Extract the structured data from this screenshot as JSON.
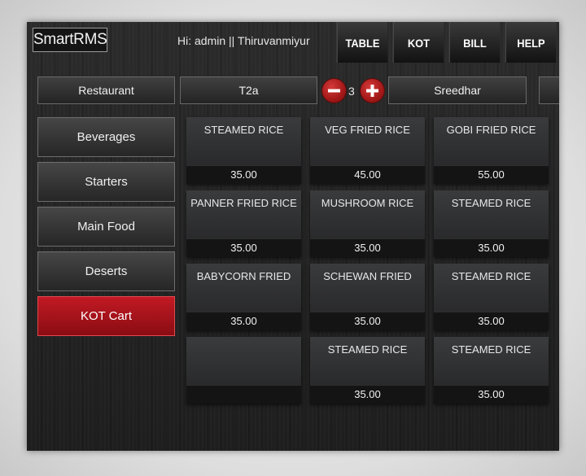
{
  "app": {
    "logo": "SmartRMS"
  },
  "header": {
    "greeting": "Hi: admin  ||  Thiruvanmiyur",
    "nav": [
      "TABLE",
      "KOT",
      "BILL",
      "HELP"
    ]
  },
  "order_bar": {
    "section": "Restaurant",
    "table": "T2a",
    "guests": "3",
    "waiter": "Sreedhar",
    "minus_icon": "minus-circle-icon",
    "plus_icon": "plus-circle-icon"
  },
  "categories": [
    "Beverages",
    "Starters",
    "Main Food",
    "Deserts",
    "KOT Cart"
  ],
  "active_category": "KOT Cart",
  "items": [
    {
      "name": "STEAMED RICE",
      "price": "35.00"
    },
    {
      "name": "VEG FRIED RICE",
      "price": "45.00"
    },
    {
      "name": "GOBI FRIED RICE",
      "price": "55.00"
    },
    {
      "name": "PANNER FRIED RICE",
      "price": "35.00"
    },
    {
      "name": "MUSHROOM RICE",
      "price": "35.00"
    },
    {
      "name": "STEAMED RICE",
      "price": "35.00"
    },
    {
      "name": "BABYCORN FRIED",
      "price": "35.00"
    },
    {
      "name": "SCHEWAN FRIED",
      "price": "35.00"
    },
    {
      "name": "STEAMED RICE",
      "price": "35.00"
    },
    {
      "name": "",
      "price": ""
    },
    {
      "name": "STEAMED RICE",
      "price": "35.00"
    },
    {
      "name": "STEAMED RICE",
      "price": "35.00"
    }
  ],
  "colors": {
    "accent": "#a8121b",
    "button_red": "#c0272d"
  }
}
